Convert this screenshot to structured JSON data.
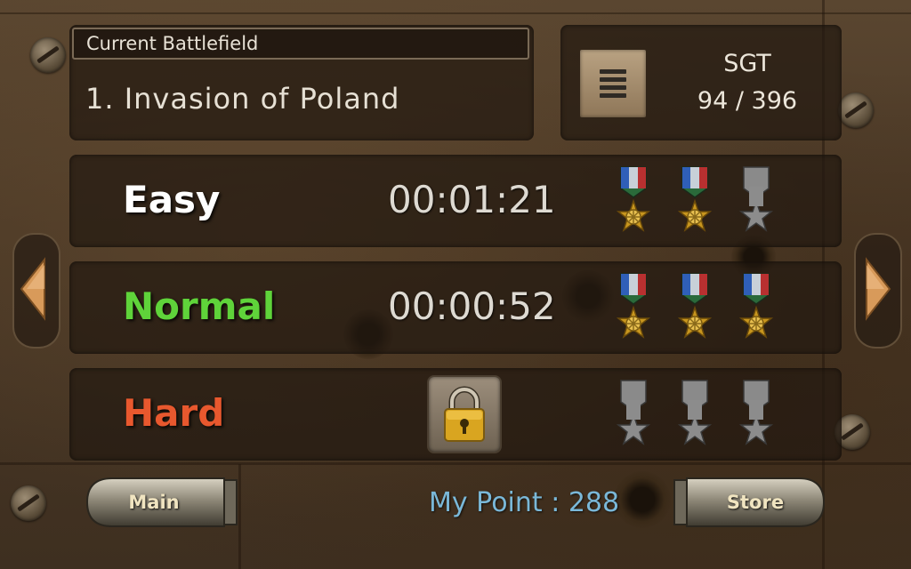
{
  "battlefield": {
    "header_label": "Current Battlefield",
    "name": "1. Invasion of Poland"
  },
  "rank": {
    "title": "SGT",
    "points": "94 / 396"
  },
  "difficulties": [
    {
      "label": "Easy",
      "color": "#ffffff",
      "time": "00:01:21",
      "medals": [
        "gold",
        "gold",
        "empty"
      ],
      "locked": false
    },
    {
      "label": "Normal",
      "color": "#5fd33a",
      "time": "00:00:52",
      "medals": [
        "gold",
        "gold",
        "gold"
      ],
      "locked": false
    },
    {
      "label": "Hard",
      "color": "#e8582e",
      "time": "",
      "medals": [
        "empty",
        "empty",
        "empty"
      ],
      "locked": true
    }
  ],
  "footer": {
    "main_label": "Main",
    "store_label": "Store",
    "my_point": "My Point : 288"
  },
  "icons": {
    "menu": "menu-icon",
    "lock": "lock-icon",
    "prev": "arrow-left-icon",
    "next": "arrow-right-icon",
    "medal": "medal-icon"
  }
}
